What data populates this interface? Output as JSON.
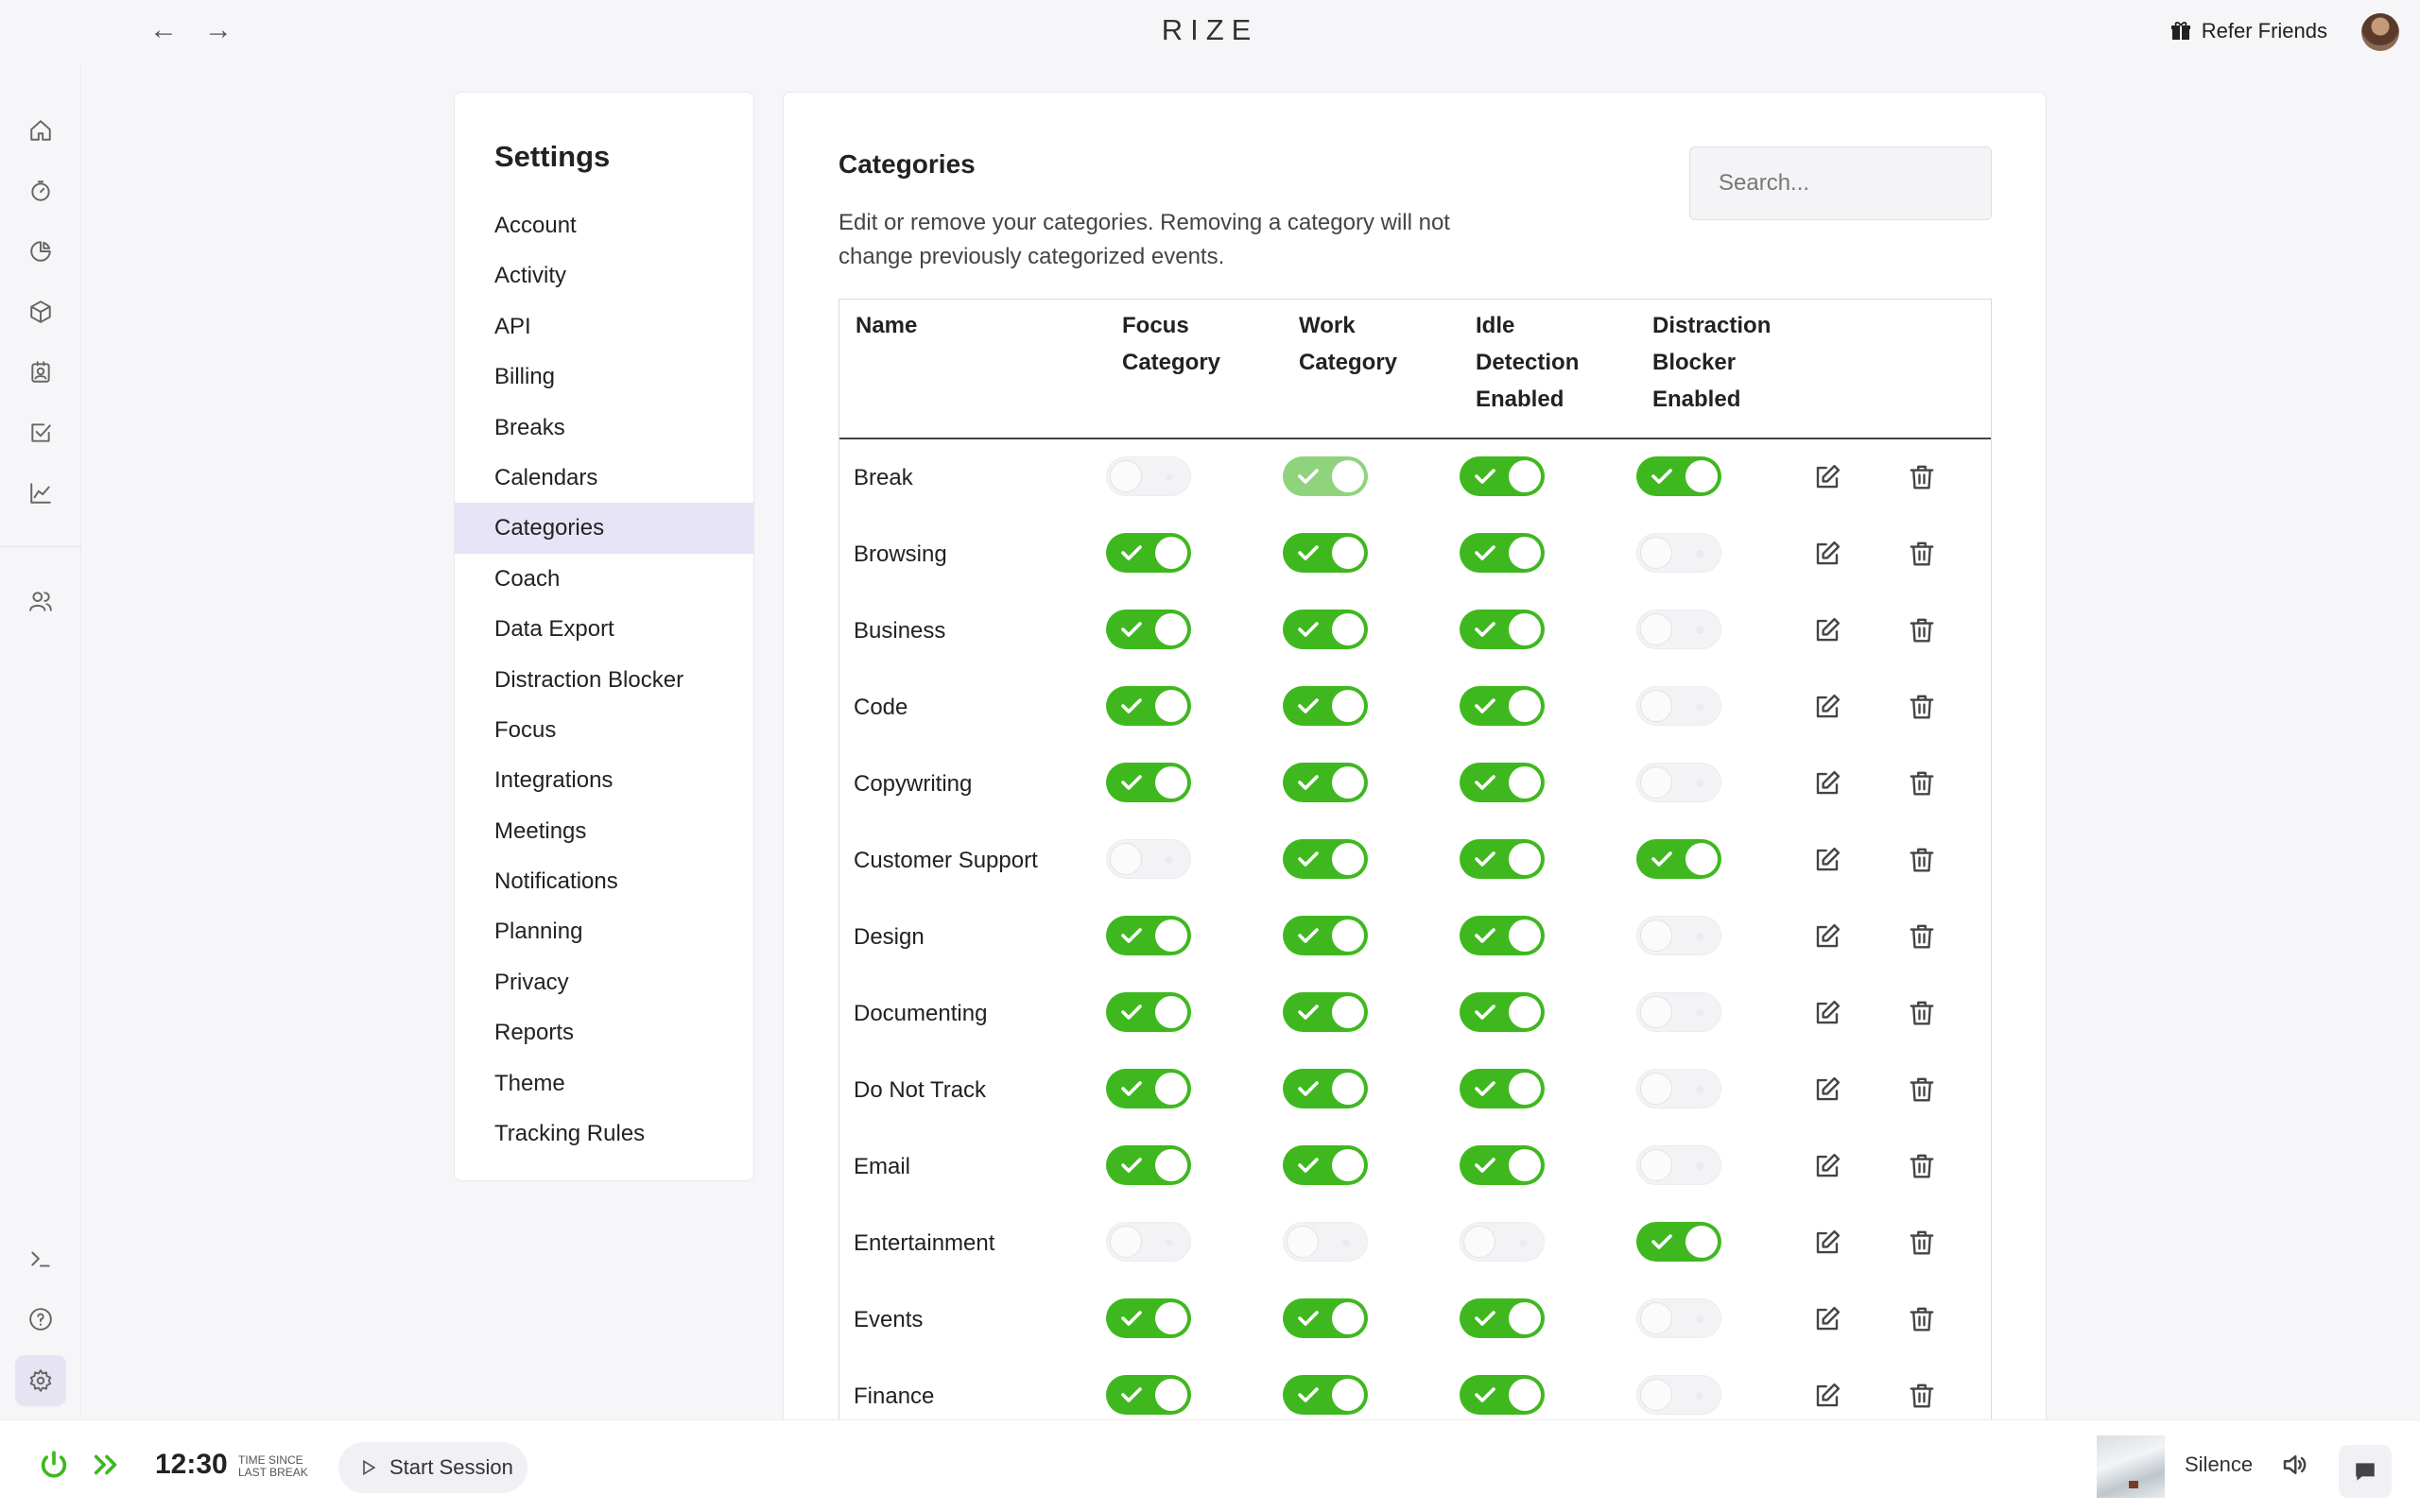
{
  "app": {
    "brand": "RIZE"
  },
  "topbar": {
    "refer_label": "Refer Friends"
  },
  "settings": {
    "title": "Settings",
    "items": [
      {
        "label": "Account"
      },
      {
        "label": "Activity"
      },
      {
        "label": "API"
      },
      {
        "label": "Billing"
      },
      {
        "label": "Breaks"
      },
      {
        "label": "Calendars"
      },
      {
        "label": "Categories",
        "active": true
      },
      {
        "label": "Coach"
      },
      {
        "label": "Data Export"
      },
      {
        "label": "Distraction Blocker"
      },
      {
        "label": "Focus"
      },
      {
        "label": "Integrations"
      },
      {
        "label": "Meetings"
      },
      {
        "label": "Notifications"
      },
      {
        "label": "Planning"
      },
      {
        "label": "Privacy"
      },
      {
        "label": "Reports"
      },
      {
        "label": "Theme"
      },
      {
        "label": "Tracking Rules"
      }
    ]
  },
  "categories": {
    "title": "Categories",
    "description": "Edit or remove your categories. Removing a category will not change previously categorized events.",
    "search_placeholder": "Search...",
    "columns": {
      "name": "Name",
      "focus_1": "Focus",
      "focus_2": "Category",
      "work_1": "Work",
      "work_2": "Category",
      "idle_1": "Idle",
      "idle_2": "Detection",
      "idle_3": "Enabled",
      "dist_1": "Distraction",
      "dist_2": "Blocker",
      "dist_3": "Enabled"
    },
    "rows": [
      {
        "name": "Break",
        "focus": false,
        "work": true,
        "work_dim": true,
        "idle": true,
        "distraction": true
      },
      {
        "name": "Browsing",
        "focus": true,
        "work": true,
        "idle": true,
        "distraction": false
      },
      {
        "name": "Business",
        "focus": true,
        "work": true,
        "idle": true,
        "distraction": false
      },
      {
        "name": "Code",
        "focus": true,
        "work": true,
        "idle": true,
        "distraction": false
      },
      {
        "name": "Copywriting",
        "focus": true,
        "work": true,
        "idle": true,
        "distraction": false
      },
      {
        "name": "Customer Support",
        "focus": false,
        "work": true,
        "idle": true,
        "distraction": true
      },
      {
        "name": "Design",
        "focus": true,
        "work": true,
        "idle": true,
        "distraction": false
      },
      {
        "name": "Documenting",
        "focus": true,
        "work": true,
        "idle": true,
        "distraction": false
      },
      {
        "name": "Do Not Track",
        "focus": true,
        "work": true,
        "idle": true,
        "distraction": false
      },
      {
        "name": "Email",
        "focus": true,
        "work": true,
        "idle": true,
        "distraction": false
      },
      {
        "name": "Entertainment",
        "focus": false,
        "work": false,
        "idle": false,
        "distraction": true
      },
      {
        "name": "Events",
        "focus": true,
        "work": true,
        "idle": true,
        "distraction": false
      },
      {
        "name": "Finance",
        "focus": true,
        "work": true,
        "idle": true,
        "distraction": false
      }
    ]
  },
  "bottombar": {
    "timer": "12:30",
    "timer_caption_1": "TIME SINCE",
    "timer_caption_2": "LAST BREAK",
    "start_label": "Start Session",
    "sound_label": "Silence"
  },
  "colors": {
    "toggle_on": "#3fb81f",
    "selected_nav": "#e6e4f6"
  },
  "icons": {
    "rail": [
      "home-icon",
      "timer-icon",
      "pie-chart-icon",
      "cube-icon",
      "contact-icon",
      "checkbox-icon",
      "line-chart-icon",
      "users-icon",
      "terminal-icon",
      "help-icon",
      "gear-icon"
    ],
    "row_actions": [
      "edit-icon",
      "trash-icon"
    ]
  }
}
